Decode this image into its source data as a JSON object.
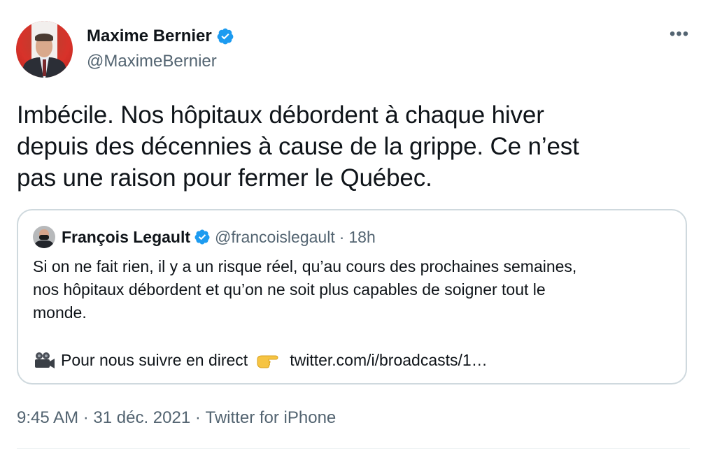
{
  "author": {
    "display_name": "Maxime Bernier",
    "handle": "@MaximeBernier",
    "verified_icon": "verified-badge-icon",
    "avatar_icon": "profile-photo"
  },
  "more_label": "•••",
  "tweet": {
    "text": "Imbécile. Nos hôpitaux débordent à chaque hiver\ndepuis des décennies à cause de la grippe. Ce n’est\npas une raison pour fermer le Québec."
  },
  "quote": {
    "display_name": "François Legault",
    "handle": "@francoislegault",
    "separator": "·",
    "time": "18h",
    "text": "Si on ne fait rien, il y a un risque réel, qu’au cours des prochaines semaines,\nnos hôpitaux débordent et qu’on ne soit plus capables de soigner tout le\nmonde.",
    "link_prefix": "Pour nous suivre en direct",
    "link": "twitter.com/i/broadcasts/1…",
    "camera_icon": "movie-camera-icon",
    "pointing_icon": "backhand-pointing-right-icon"
  },
  "meta": {
    "time": "9:45 AM",
    "sep1": " · ",
    "date": "31 déc. 2021",
    "sep2": " · ",
    "source": "Twitter for iPhone"
  },
  "colors": {
    "verified": "#1d9bf0",
    "secondary_text": "#536471",
    "border": "#cfd9de",
    "link": "#0f1419"
  }
}
